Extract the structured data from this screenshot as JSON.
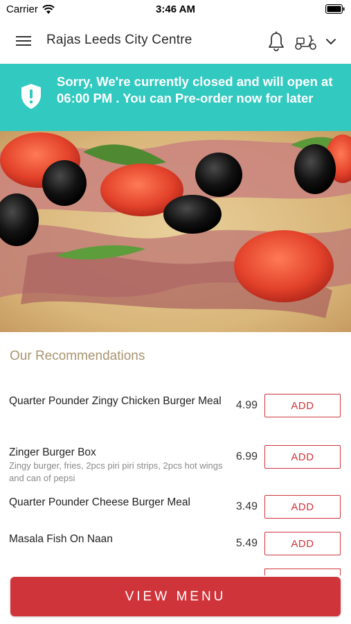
{
  "status_bar": {
    "carrier": "Carrier",
    "time": "3:46 AM"
  },
  "header": {
    "store_name": "Rajas Leeds City Centre"
  },
  "banner": {
    "message": "Sorry, We're currently closed and will open at 06:00 PM . You can Pre-order now for later",
    "color": "#32c9c0"
  },
  "recommendations": {
    "title": "Our Recommendations",
    "items": [
      {
        "name": "Quarter Pounder Zingy Chicken Burger Meal",
        "description": "",
        "price": "4.99",
        "button": "ADD"
      },
      {
        "name": "Zinger Burger Box",
        "description": "Zingy burger, fries, 2pcs piri piri strips, 2pcs hot wings and can of pepsi",
        "price": "6.99",
        "button": "ADD"
      },
      {
        "name": "Quarter Pounder Cheese Burger Meal",
        "description": "",
        "price": "3.49",
        "button": "ADD"
      },
      {
        "name": "Masala Fish On Naan",
        "description": "",
        "price": "5.49",
        "button": "ADD"
      }
    ]
  },
  "footer": {
    "view_menu_label": "VIEW MENU"
  },
  "colors": {
    "accent": "#d0343b",
    "title_gold": "#a89570"
  }
}
